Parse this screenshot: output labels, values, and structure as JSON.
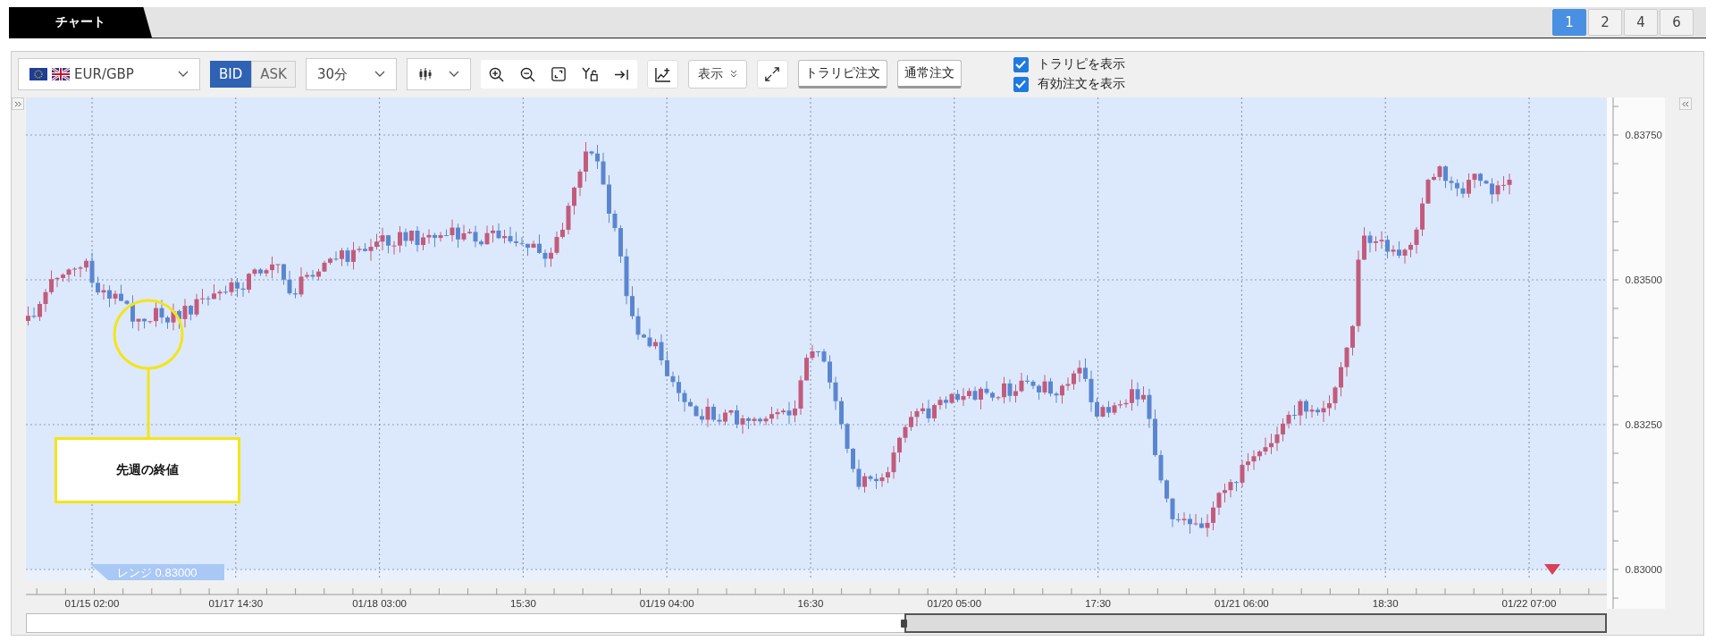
{
  "tab": {
    "label": "チャート",
    "selected": true
  },
  "layout_buttons": [
    {
      "label": "1",
      "selected": true
    },
    {
      "label": "2",
      "selected": false
    },
    {
      "label": "4",
      "selected": false
    },
    {
      "label": "6",
      "selected": false
    }
  ],
  "toolbar": {
    "symbol": "EUR/GBP",
    "interval": "30分",
    "display_button": "表示",
    "trailing_order_button": "トラリピ注文",
    "normal_order_button": "通常注文",
    "price_side": [
      {
        "label": "BID",
        "selected": true
      },
      {
        "label": "ASK",
        "selected": false
      }
    ]
  },
  "options": [
    {
      "label": "トラリピを表示",
      "checked": true
    },
    {
      "label": "有効注文を表示",
      "checked": true
    }
  ],
  "chart": {
    "annotation": "先週の終値",
    "range_label": "レンジ 0.83000",
    "y_axis_labels": [
      "0.83750",
      "0.83500",
      "0.83250",
      "0.83000"
    ],
    "x_axis_labels": [
      "01/15 02:00",
      "01/17 14:30",
      "01/18 03:00",
      "15:30",
      "01/19 04:00",
      "16:30",
      "01/20 05:00",
      "17:30",
      "01/21 06:00",
      "18:30",
      "01/22 07:00"
    ]
  }
}
